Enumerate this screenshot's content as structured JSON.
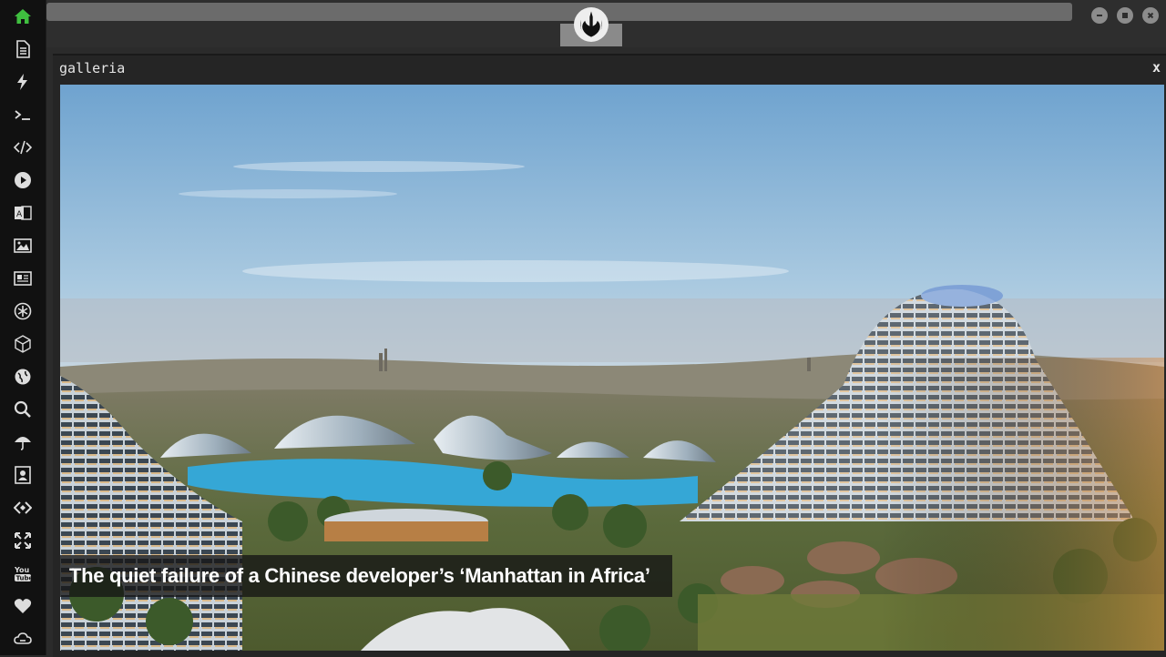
{
  "window": {
    "panel_title": "galleria",
    "close_label": "x"
  },
  "gallery": {
    "caption": "The quiet failure of a Chinese developer’s ‘Manhattan in Africa’"
  },
  "sidebar": {
    "items": [
      {
        "icon": "home-icon",
        "active": true
      },
      {
        "icon": "document-icon"
      },
      {
        "icon": "lightning-icon"
      },
      {
        "icon": "terminal-icon"
      },
      {
        "icon": "code-icon"
      },
      {
        "icon": "play-icon"
      },
      {
        "icon": "translate-icon"
      },
      {
        "icon": "image-icon"
      },
      {
        "icon": "newspaper-icon"
      },
      {
        "icon": "asterisk-icon"
      },
      {
        "icon": "cube-icon"
      },
      {
        "icon": "globe-icon"
      },
      {
        "icon": "search-icon"
      },
      {
        "icon": "umbrella-icon"
      },
      {
        "icon": "contact-card-icon"
      },
      {
        "icon": "code-diamond-icon"
      },
      {
        "icon": "expand-icon"
      },
      {
        "icon": "youtube-icon"
      },
      {
        "icon": "heart-icon"
      },
      {
        "icon": "cloud-icon"
      }
    ]
  },
  "colors": {
    "accent_home": "#3fbf3f",
    "sidebar_bg": "#111111",
    "topbar_bg": "#2e2e2e"
  }
}
